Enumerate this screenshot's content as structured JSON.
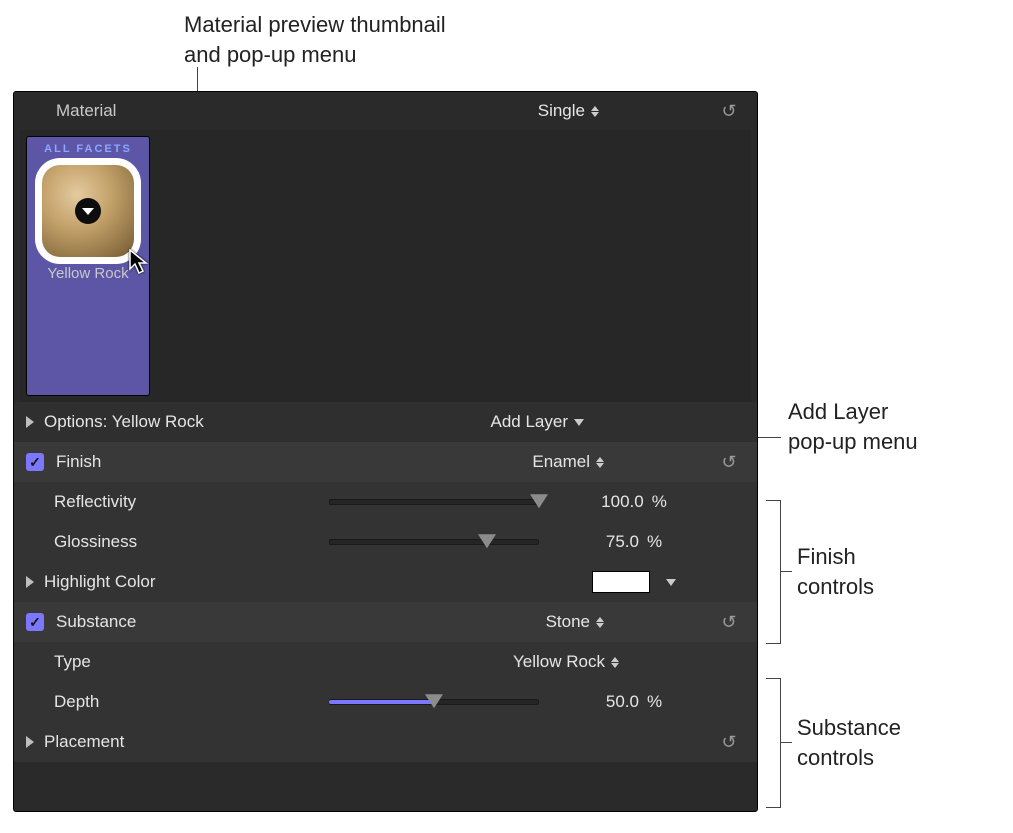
{
  "callouts": {
    "thumbnail": "Material preview thumbnail\nand pop-up menu",
    "addlayer": "Add Layer\npop-up menu",
    "finish": "Finish\ncontrols",
    "substance": "Substance\ncontrols"
  },
  "header": {
    "title": "Material",
    "mode": "Single"
  },
  "facet": {
    "heading": "ALL FACETS",
    "name": "Yellow Rock"
  },
  "options": {
    "label": "Options: Yellow Rock",
    "addlayer": "Add Layer"
  },
  "finish": {
    "title": "Finish",
    "type": "Enamel",
    "reflectivity": {
      "label": "Reflectivity",
      "value": "100.0",
      "unit": "%",
      "pct": 100
    },
    "glossiness": {
      "label": "Glossiness",
      "value": "75.0",
      "unit": "%",
      "pct": 75
    },
    "highlight": {
      "label": "Highlight Color",
      "color": "#ffffff"
    }
  },
  "substance": {
    "title": "Substance",
    "type": "Stone",
    "typeRow": {
      "label": "Type",
      "value": "Yellow Rock"
    },
    "depth": {
      "label": "Depth",
      "value": "50.0",
      "unit": "%",
      "pct": 50
    },
    "placement": {
      "label": "Placement"
    }
  }
}
